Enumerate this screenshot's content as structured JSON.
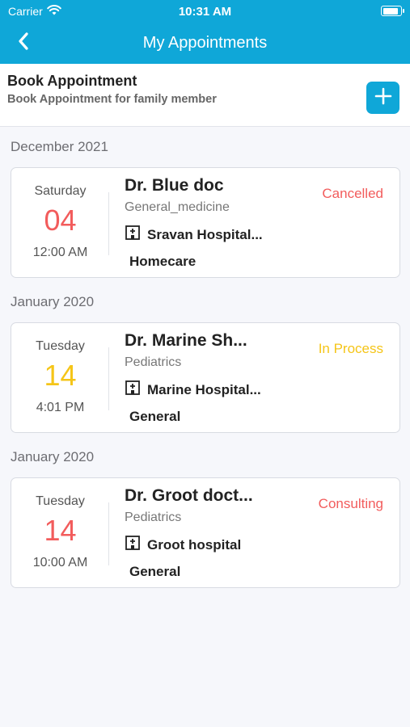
{
  "status_bar": {
    "carrier": "Carrier",
    "time": "10:31 AM",
    "battery_level": 0.9
  },
  "nav": {
    "title": "My Appointments",
    "back_icon": "chevron-left-icon"
  },
  "book": {
    "title": "Book Appointment",
    "subtitle": "Book Appointment for family member",
    "add_icon": "plus-icon"
  },
  "groups": [
    {
      "header": "December 2021"
    },
    {
      "header": "January 2020"
    },
    {
      "header": "January 2020"
    }
  ],
  "appointments": [
    {
      "day": "Saturday",
      "date": "04",
      "time": "12:00 AM",
      "doctor": "Dr. Blue doc",
      "specialty": "General_medicine",
      "hospital": "Sravan Hospital...",
      "type": "Homecare",
      "status": "Cancelled",
      "status_color": "#f25c5c",
      "date_color": "#f25c5c"
    },
    {
      "day": "Tuesday",
      "date": "14",
      "time": "4:01 PM",
      "doctor": "Dr. Marine Sh...",
      "specialty": "Pediatrics",
      "hospital": "Marine Hospital...",
      "type": "General",
      "status": "In Process",
      "status_color": "#f5c518",
      "date_color": "#f5c518"
    },
    {
      "day": "Tuesday",
      "date": "14",
      "time": "10:00 AM",
      "doctor": "Dr. Groot doct...",
      "specialty": "Pediatrics",
      "hospital": "Groot hospital",
      "type": "General",
      "status": "Consulting",
      "status_color": "#f25c5c",
      "date_color": "#f25c5c"
    }
  ]
}
